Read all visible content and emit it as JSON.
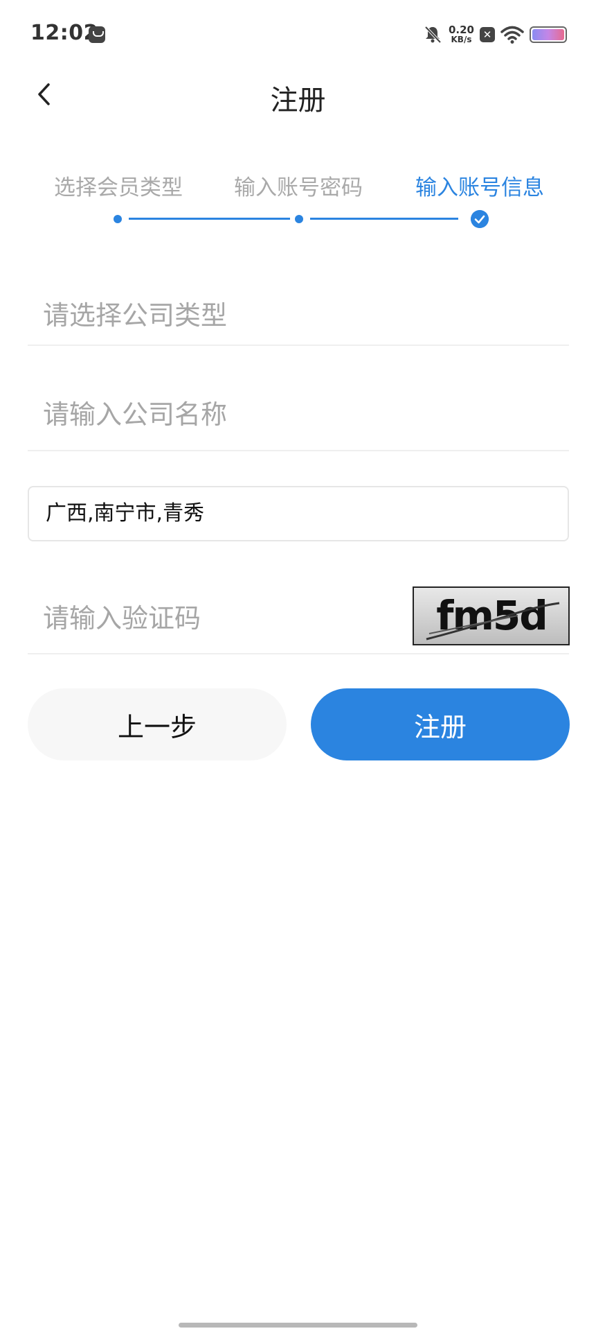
{
  "status_bar": {
    "time": "12:02",
    "net_speed_value": "0.20",
    "net_speed_unit": "KB/s",
    "icons": [
      "notification-app-icon",
      "mute-bell-icon",
      "close-badge-icon",
      "wifi-icon",
      "battery-icon"
    ]
  },
  "header": {
    "title": "注册",
    "back_icon": "chevron-left-icon"
  },
  "steps": [
    {
      "label": "选择会员类型",
      "state": "done"
    },
    {
      "label": "输入账号密码",
      "state": "done"
    },
    {
      "label": "输入账号信息",
      "state": "current"
    }
  ],
  "form": {
    "company_type_placeholder": "请选择公司类型",
    "company_name_placeholder": "请输入公司名称",
    "region_value": "广西,南宁市,青秀",
    "captcha_placeholder": "请输入验证码",
    "captcha_text": "fm5d"
  },
  "buttons": {
    "prev_label": "上一步",
    "register_label": "注册"
  },
  "colors": {
    "accent": "#2b84e0",
    "inactive_text": "#a9a9a9",
    "placeholder": "#a6a6a6"
  }
}
